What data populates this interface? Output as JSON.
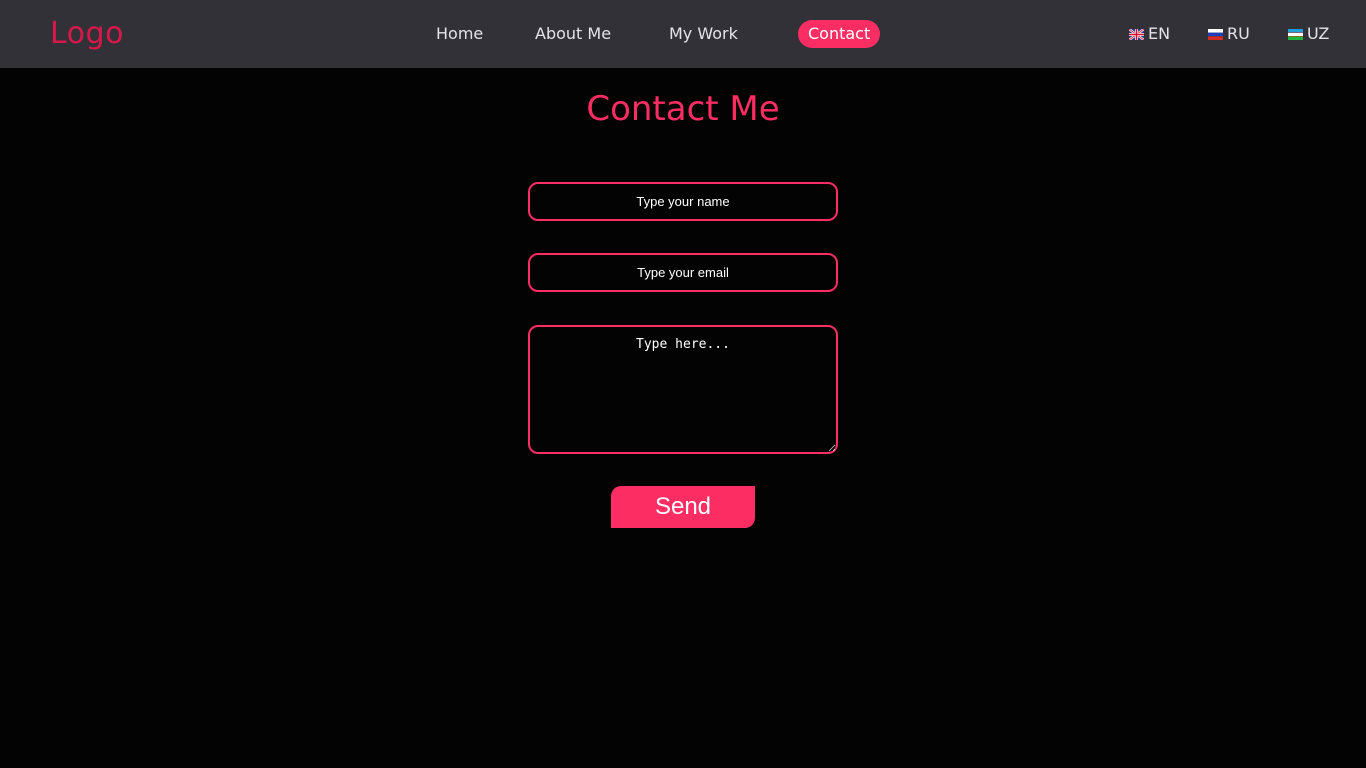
{
  "header": {
    "logo": "Logo",
    "nav": [
      {
        "label": "Home",
        "active": false
      },
      {
        "label": "About Me",
        "active": false
      },
      {
        "label": "My Work",
        "active": false
      },
      {
        "label": "Contact",
        "active": true
      }
    ],
    "languages": [
      {
        "code": "EN",
        "flag": "uk-flag-icon"
      },
      {
        "code": "RU",
        "flag": "russia-flag-icon"
      },
      {
        "code": "UZ",
        "flag": "uzbekistan-flag-icon"
      }
    ]
  },
  "contact": {
    "title": "Contact Me",
    "name_field": {
      "value": "",
      "placeholder": "Type your name"
    },
    "email_field": {
      "value": "",
      "placeholder": "Type your email"
    },
    "message_field": {
      "value": "",
      "placeholder": "Type here..."
    },
    "send_label": "Send"
  },
  "colors": {
    "accent": "#fb2d62",
    "logo": "#d8184a",
    "navbar_bg": "#323137",
    "page_bg": "#030303",
    "nav_text": "#e4e4e8"
  }
}
